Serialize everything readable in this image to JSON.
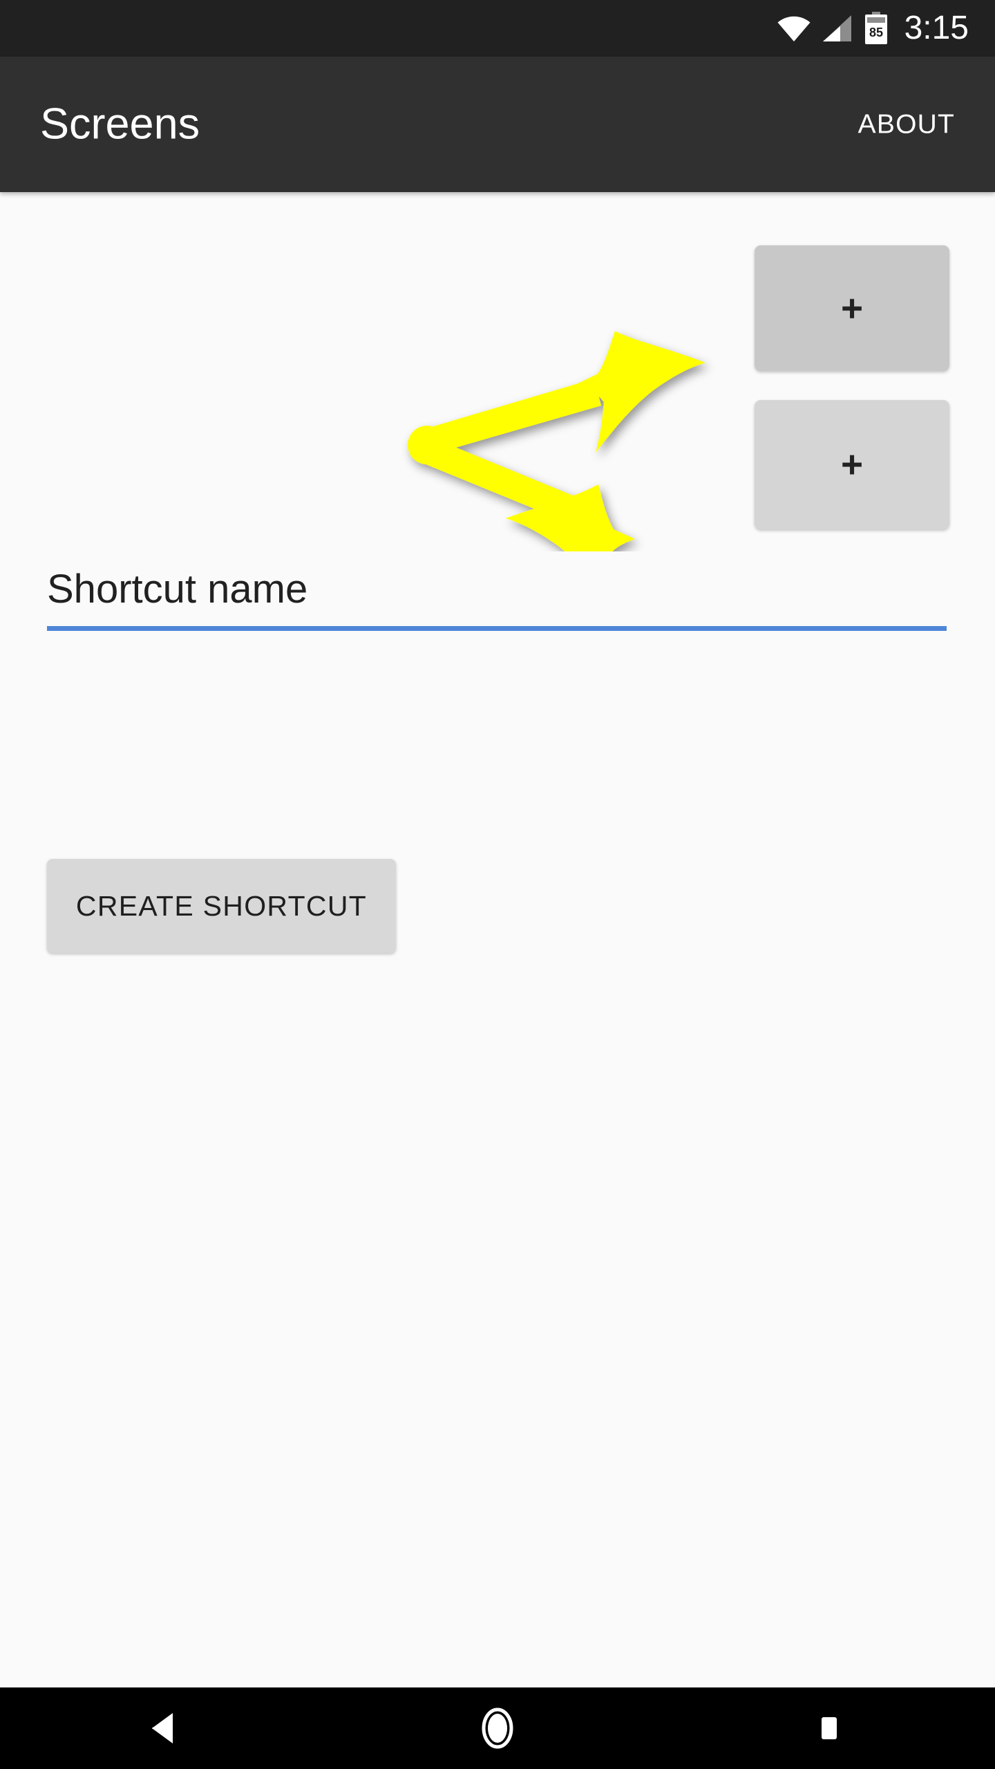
{
  "status_bar": {
    "time": "3:15",
    "battery_level": "85",
    "icons": [
      "wifi-icon",
      "cell-signal-icon",
      "battery-icon"
    ],
    "background_color": "#212121"
  },
  "app_bar": {
    "title": "Screens",
    "action_label": "ABOUT",
    "background_color": "#303030",
    "text_color": "#ffffff"
  },
  "content": {
    "background_color": "#fafafa",
    "screen_tiles": [
      {
        "label": "+",
        "fill_color": "#c8c8c8"
      },
      {
        "label": "+",
        "fill_color": "#d5d5d5"
      }
    ],
    "shortcut_name_field": {
      "value": "",
      "placeholder": "Shortcut name",
      "underline_color": "#4e86d8"
    },
    "create_button": {
      "label": "CREATE SHORTCUT",
      "fill_color": "#d8d8d8"
    },
    "annotation": {
      "type": "double-arrow-pointer",
      "color": "#ffff00",
      "description": "Yellow branching arrow pointing at both screen tiles"
    }
  },
  "nav_bar": {
    "background_color": "#000000",
    "buttons": [
      {
        "name": "back-icon",
        "label": "Back"
      },
      {
        "name": "home-icon",
        "label": "Home"
      },
      {
        "name": "recents-icon",
        "label": "Recents"
      }
    ]
  }
}
